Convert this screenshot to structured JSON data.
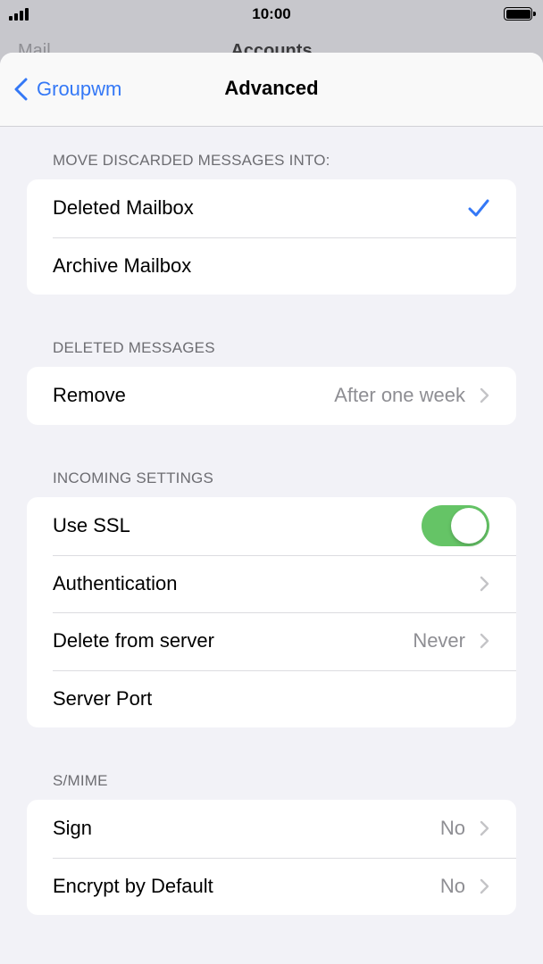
{
  "status_bar": {
    "time": "10:00"
  },
  "behind": {
    "back_label": "Mail",
    "title": "Accounts"
  },
  "nav": {
    "back_label": "Groupwm",
    "title": "Advanced"
  },
  "sections": {
    "discarded": {
      "header": "MOVE DISCARDED MESSAGES INTO:",
      "rows": [
        {
          "label": "Deleted Mailbox",
          "checked": true
        },
        {
          "label": "Archive Mailbox",
          "checked": false
        }
      ]
    },
    "deleted": {
      "header": "DELETED MESSAGES",
      "rows": [
        {
          "label": "Remove",
          "value": "After one week"
        }
      ]
    },
    "incoming": {
      "header": "INCOMING SETTINGS",
      "rows": [
        {
          "label": "Use SSL",
          "toggle": true
        },
        {
          "label": "Authentication"
        },
        {
          "label": "Delete from server",
          "value": "Never"
        },
        {
          "label": "Server Port",
          "value": ""
        }
      ]
    },
    "smime": {
      "header": "S/MIME",
      "rows": [
        {
          "label": "Sign",
          "value": "No"
        },
        {
          "label": "Encrypt by Default",
          "value": "No"
        }
      ]
    }
  },
  "colors": {
    "accent": "#3478f6",
    "toggle_on": "#65c466",
    "secondary_text": "#8e8e93"
  },
  "icons": [
    "chevron-left-icon",
    "checkmark-icon",
    "chevron-right-icon"
  ]
}
